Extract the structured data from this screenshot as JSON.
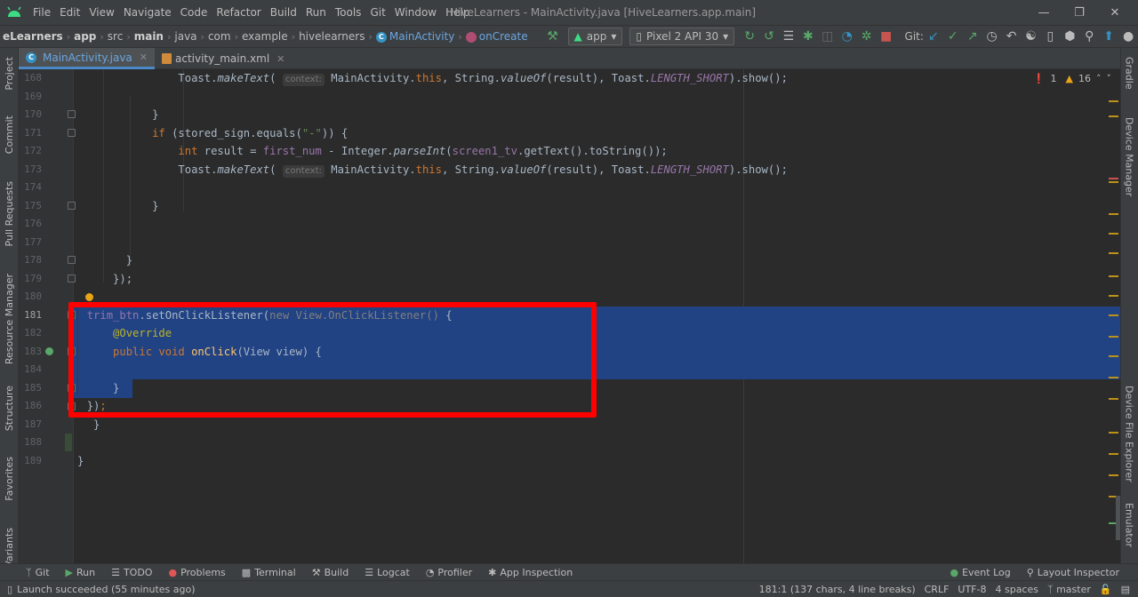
{
  "window": {
    "title": "HiveLearners - MainActivity.java [HiveLearners.app.main]"
  },
  "menu": [
    "File",
    "Edit",
    "View",
    "Navigate",
    "Code",
    "Refactor",
    "Build",
    "Run",
    "Tools",
    "Git",
    "Window",
    "Help"
  ],
  "breadcrumbs": [
    "eLearners",
    "app",
    "src",
    "main",
    "java",
    "com",
    "example",
    "hivelearners",
    "MainActivity",
    "onCreate"
  ],
  "toolbar": {
    "run_config": "app",
    "device": "Pixel 2 API 30",
    "git_label": "Git:"
  },
  "tabs": [
    {
      "label": "MainActivity.java",
      "active": true
    },
    {
      "label": "activity_main.xml",
      "active": false
    }
  ],
  "inspection": {
    "errors": "1",
    "warnings": "16"
  },
  "left_tools": [
    "Project",
    "Commit",
    "Pull Requests",
    "Resource Manager",
    "Structure",
    "Favorites",
    "Variants"
  ],
  "right_tools": [
    "Gradle",
    "Device Manager",
    "Device File Explorer",
    "Emulator"
  ],
  "line_numbers": [
    "168",
    "169",
    "170",
    "171",
    "172",
    "173",
    "174",
    "175",
    "176",
    "177",
    "178",
    "179",
    "180",
    "181",
    "182",
    "183",
    "184",
    "185",
    "186",
    "187",
    "188",
    "189"
  ],
  "code": {
    "l168_a": "Toast.",
    "l168_b": "makeText",
    "l168_c": "( ",
    "l168_hint": "context:",
    "l168_d": " MainActivity.",
    "l168_e": "this",
    "l168_f": ", String.",
    "l168_g": "valueOf",
    "l168_h": "(result), Toast.",
    "l168_i": "LENGTH_SHORT",
    "l168_j": ").show();",
    "l170": "}",
    "l171_a": "if",
    "l171_b": " (stored_sign.equals(",
    "l171_c": "\"-\"",
    "l171_d": ")) {",
    "l172_a": "int",
    "l172_b": " result = ",
    "l172_c": "first_num",
    "l172_d": " - Integer.",
    "l172_e": "parseInt",
    "l172_f": "(",
    "l172_g": "screen1_tv",
    "l172_h": ".getText().toString());",
    "l173_a": "Toast.",
    "l173_b": "makeText",
    "l173_c": "( ",
    "l173_hint": "context:",
    "l173_d": " MainActivity.",
    "l173_e": "this",
    "l173_f": ", String.",
    "l173_g": "valueOf",
    "l173_h": "(result), Toast.",
    "l173_i": "LENGTH_SHORT",
    "l173_j": ").show();",
    "l175": "}",
    "l178": "}",
    "l179": "});",
    "l181_a": "trim_btn",
    "l181_b": ".setOnClickListener(",
    "l181_c": "new View.OnClickListener()",
    "l181_d": " {",
    "l182": "@Override",
    "l183_a": "public void ",
    "l183_b": "onClick",
    "l183_c": "(View view) {",
    "l185": "}",
    "l186_a": "})",
    "l186_b": ";",
    "l187": "}",
    "l189": "}"
  },
  "bottom_tabs": [
    "Git",
    "Run",
    "TODO",
    "Problems",
    "Terminal",
    "Build",
    "Logcat",
    "Profiler",
    "App Inspection",
    "Event Log",
    "Layout Inspector"
  ],
  "status": {
    "message": "Launch succeeded (55 minutes ago)",
    "position": "181:1 (137 chars, 4 line breaks)",
    "line_sep": "CRLF",
    "encoding": "UTF-8",
    "indent": "4 spaces",
    "branch": "master"
  },
  "colors": {
    "selection": "#214283",
    "highlight_box": "#ff0000",
    "keyword": "#cc7832",
    "field": "#9876aa",
    "string": "#6a8759",
    "method": "#ffc66d"
  }
}
